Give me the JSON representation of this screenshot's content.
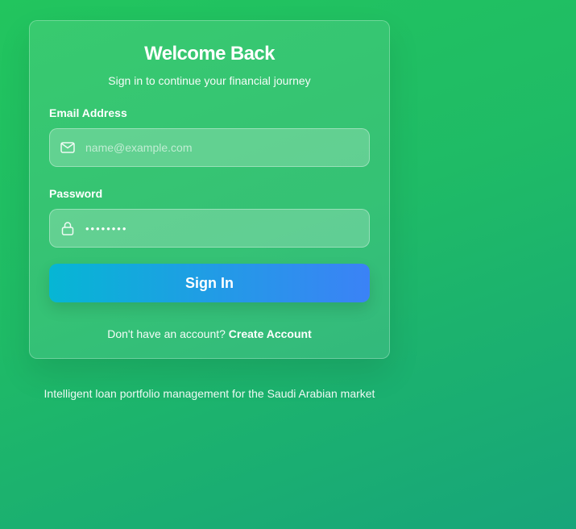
{
  "card": {
    "title": "Welcome Back",
    "subtitle": "Sign in to continue your financial journey"
  },
  "form": {
    "email": {
      "label": "Email Address",
      "placeholder": "name@example.com",
      "icon": "mail-icon"
    },
    "password": {
      "label": "Password",
      "value": "••••••••",
      "icon": "lock-icon"
    },
    "submit_label": "Sign In"
  },
  "signup": {
    "prompt": "Don't have an account?",
    "link_label": "Create Account"
  },
  "footer": {
    "tagline": "Intelligent loan portfolio management for the Saudi Arabian market"
  },
  "colors": {
    "background_start": "#22c55e",
    "background_end": "#17a57a",
    "button_start": "#06b6d4",
    "button_end": "#3b82f6"
  }
}
